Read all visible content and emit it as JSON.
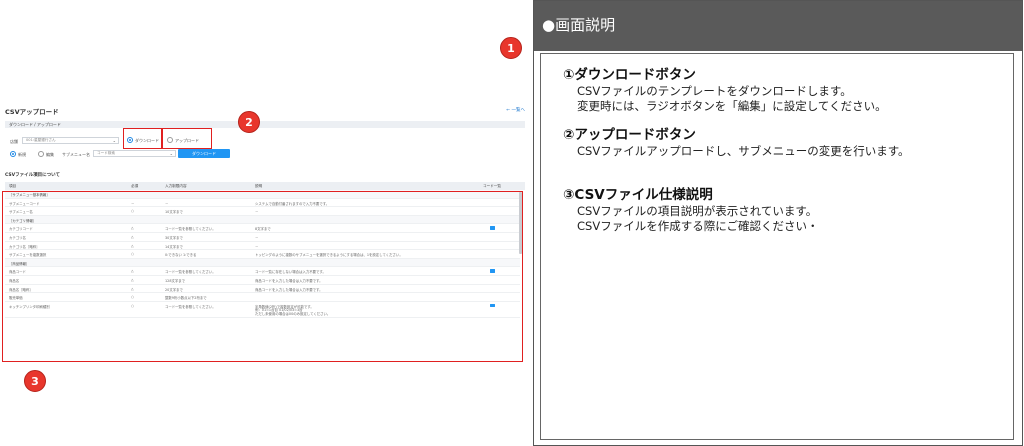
{
  "app": {
    "title": "CSVアップロード",
    "back_label": "← 一覧へ",
    "section_dlul": "ダウンロード / アップロード",
    "store_label": "店舗",
    "store_value": "001:星屋銀行さん",
    "radio_download": "ダウンロード",
    "radio_upload": "アップロード",
    "radio_new": "新規",
    "radio_edit": "編集",
    "submenu_label": "サブメニュー名",
    "submenu_placeholder": "コード検索",
    "download_button": "ダウンロード",
    "spec_title": "CSVファイル項目について",
    "table_headers": [
      "項目",
      "必須",
      "入力制限内容",
      "説明",
      "コード一覧"
    ],
    "rows": [
      {
        "type": "group",
        "c1": "［サブメニュー基本情報］"
      },
      {
        "c1": "サブメニューコード",
        "c2": "－",
        "c3": "－",
        "c4": "システムで自動付番されますので入力不要です。"
      },
      {
        "c1": "サブメニュー名",
        "c2": "○",
        "c3": "10文字まで",
        "c4": "－"
      },
      {
        "type": "group",
        "c1": "［カテゴリ情報］"
      },
      {
        "c1": "カテゴリコード",
        "c2": "△",
        "c3": "コード一覧を参照してください。",
        "c4": "8文字まで",
        "icon": true
      },
      {
        "c1": "カテゴリ名",
        "c2": "△",
        "c3": "30文字まで",
        "c4": "－"
      },
      {
        "c1": "カテゴリ名［略称］",
        "c2": "△",
        "c3": "14文字まで",
        "c4": "－"
      },
      {
        "c1": "サブメニューを複数選択",
        "c2": "○",
        "c3": "0:できない 1:できる",
        "c4": "トッピングのように複数のサブメニューを選択できるようにする場合は、1を設定してください。"
      },
      {
        "type": "group",
        "c1": "［商品情報］"
      },
      {
        "c1": "商品コード",
        "c2": "△",
        "c3": "コード一覧を参照してください。",
        "c4": "コード一覧に存在しない場合は入力不要です。",
        "icon": true
      },
      {
        "c1": "商品名",
        "c2": "△",
        "c3": "128文字まで",
        "c4": "商品コードを入力した場合は入力不要です。"
      },
      {
        "c1": "商品名［略称］",
        "c2": "△",
        "c3": "20文字まで",
        "c4": "商品コードを入力した場合は入力不要です。"
      },
      {
        "c1": "販売単価",
        "c2": "○",
        "c3": "整数9桁小数点以下2桁まで",
        "c4": ""
      },
      {
        "type": "tall",
        "c1": "キッチンプリンタ印刷種別",
        "c2": "○",
        "c3": "コード一覧を参照してください。",
        "c4": "半角数値(2桁)で複数設定が可能です。",
        "c4b": "例：01=1台目 01/02/03=3台",
        "c4c": "ただし未使用の場合は00のみ設定してください。",
        "icon": true
      }
    ]
  },
  "badges": [
    "1",
    "2",
    "3"
  ],
  "panel": {
    "header": "●画面説明",
    "sections": [
      {
        "title": "①ダウンロードボタン",
        "lines": [
          "CSVファイルのテンプレートをダウンロードします。",
          "変更時には、ラジオボタンを「編集」に設定してください。"
        ]
      },
      {
        "title": "②アップロードボタン",
        "lines": [
          "CSVファイルアップロードし、サブメニューの変更を行います。"
        ]
      },
      {
        "title": "③CSVファイル仕様説明",
        "lines": [
          "CSVファイルの項目説明が表示されています。",
          "CSVファイルを作成する際にご確認ください・"
        ]
      }
    ]
  },
  "colors": {
    "accent": "#2196f3",
    "highlight": "#e02020",
    "badge": "#e8362c",
    "panel_header": "#5a5a5a"
  }
}
